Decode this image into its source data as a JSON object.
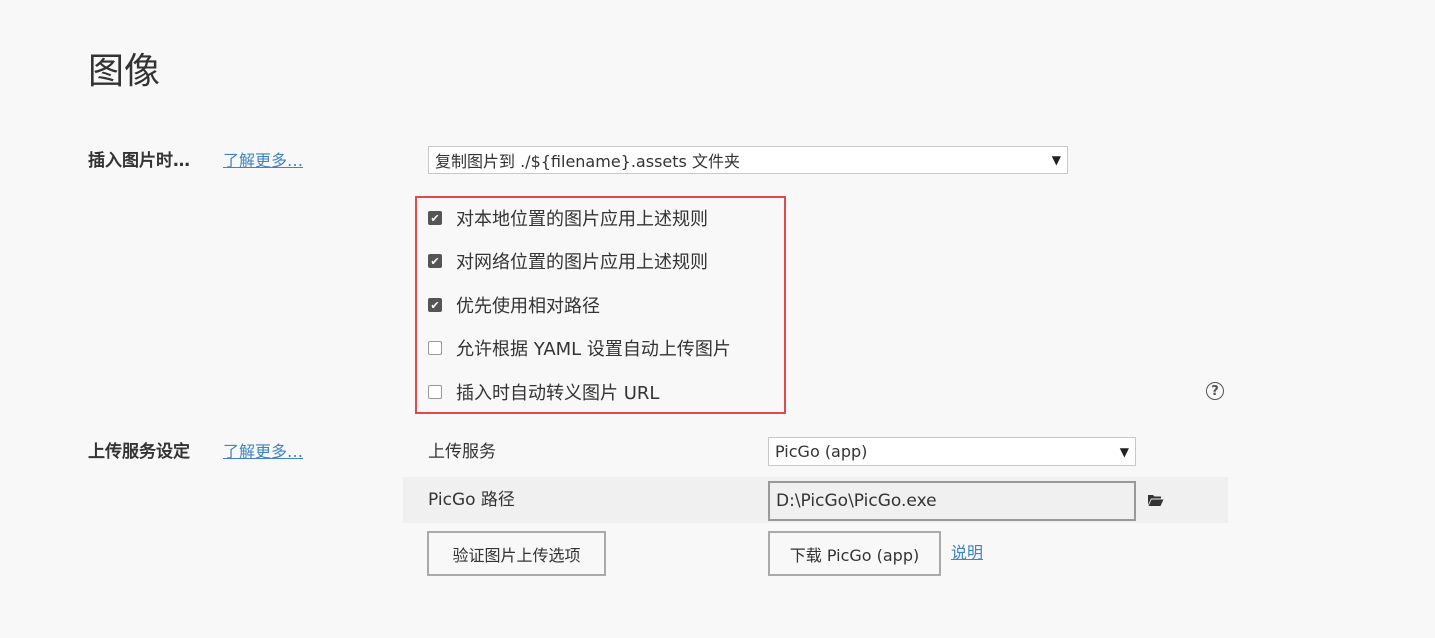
{
  "page": {
    "title": "图像"
  },
  "insert_image": {
    "label": "插入图片时…",
    "learn_more": "了解更多…",
    "action_select": "复制图片到 ./${filename}.assets 文件夹",
    "options": [
      {
        "label": "对本地位置的图片应用上述规则",
        "checked": true
      },
      {
        "label": "对网络位置的图片应用上述规则",
        "checked": true
      },
      {
        "label": "优先使用相对路径",
        "checked": true
      },
      {
        "label": "允许根据 YAML 设置自动上传图片",
        "checked": false
      },
      {
        "label": "插入时自动转义图片 URL",
        "checked": false
      }
    ]
  },
  "upload_service": {
    "label": "上传服务设定",
    "learn_more": "了解更多…",
    "service_label": "上传服务",
    "service_select": "PicGo (app)",
    "path_label": "PicGo 路径",
    "path_value": "D:\\PicGo\\PicGo.exe",
    "verify_button": "验证图片上传选项",
    "download_button": "下载 PicGo (app)",
    "explain_link": "说明"
  },
  "icons": {
    "help": "question-circle-icon",
    "folder": "folder-open-icon",
    "check": "checkmark-icon"
  },
  "colors": {
    "highlight": "#e04a4a",
    "link": "#4183c4"
  }
}
